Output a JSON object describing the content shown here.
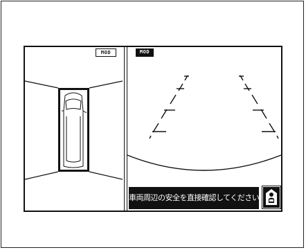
{
  "views": {
    "top_view": {
      "mode_label": "MOD"
    },
    "rear_view": {
      "mode_label": "MOD"
    }
  },
  "message": {
    "text": "車両周辺の安全を直接確認してください"
  },
  "icons": {
    "caution": "driver-caution-icon",
    "vehicle": "vehicle-top-icon"
  },
  "colors": {
    "foreground": "#111111",
    "background": "#ffffff"
  }
}
